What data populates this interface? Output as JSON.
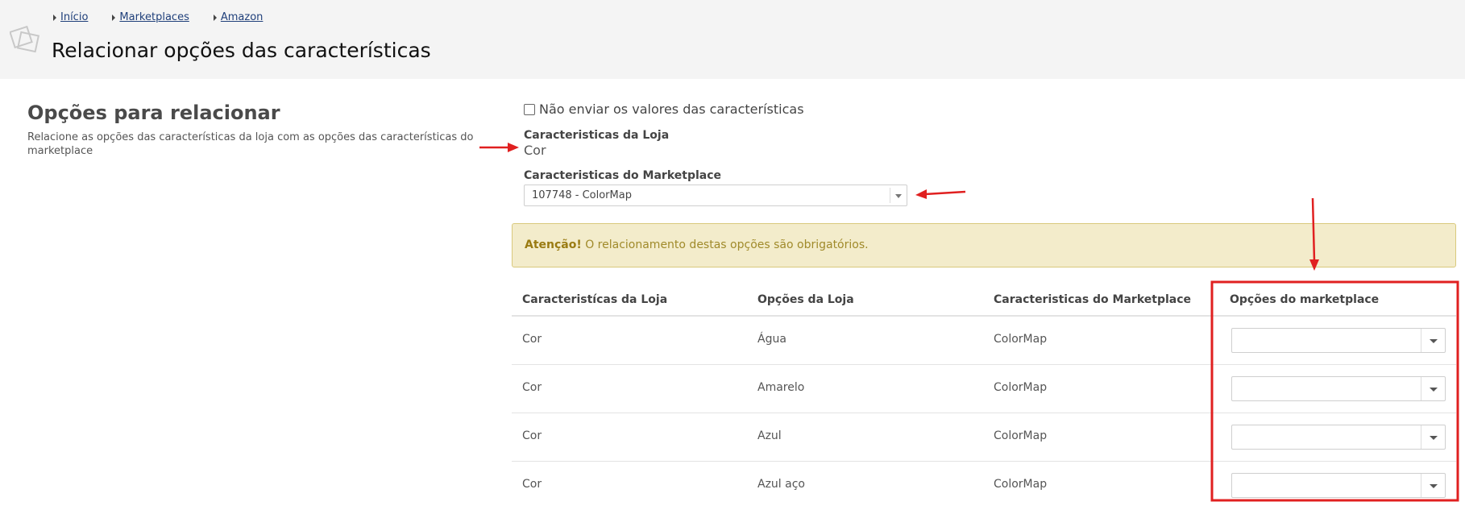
{
  "breadcrumb": [
    "Início",
    "Marketplaces",
    "Amazon"
  ],
  "page_title": "Relacionar opções das características",
  "section": {
    "title": "Opções para relacionar",
    "description": "Relacione as opções das características da loja com as opções das características do marketplace"
  },
  "form": {
    "no_send_label": "Não enviar os valores das características",
    "store_label": "Caracteristicas da Loja",
    "store_value": "Cor",
    "marketplace_label": "Caracteristicas do Marketplace",
    "marketplace_selected": "107748 - ColorMap"
  },
  "alert": {
    "strong": "Atenção!",
    "text": " O relacionamento destas opções são obrigatórios."
  },
  "table": {
    "headers": [
      "Caracteristícas da Loja",
      "Opções da Loja",
      "Caracteristicas do Marketplace",
      "Opções do marketplace"
    ],
    "rows": [
      {
        "store_char": "Cor",
        "store_option": "Água",
        "mk_char": "ColorMap",
        "mk_option": ""
      },
      {
        "store_char": "Cor",
        "store_option": "Amarelo",
        "mk_char": "ColorMap",
        "mk_option": ""
      },
      {
        "store_char": "Cor",
        "store_option": "Azul",
        "mk_char": "ColorMap",
        "mk_option": ""
      },
      {
        "store_char": "Cor",
        "store_option": "Azul aço",
        "mk_char": "ColorMap",
        "mk_option": ""
      }
    ]
  },
  "colors": {
    "annotation_red": "#e02020",
    "alert_bg": "#f3eccb",
    "link": "#1f3f7a"
  }
}
